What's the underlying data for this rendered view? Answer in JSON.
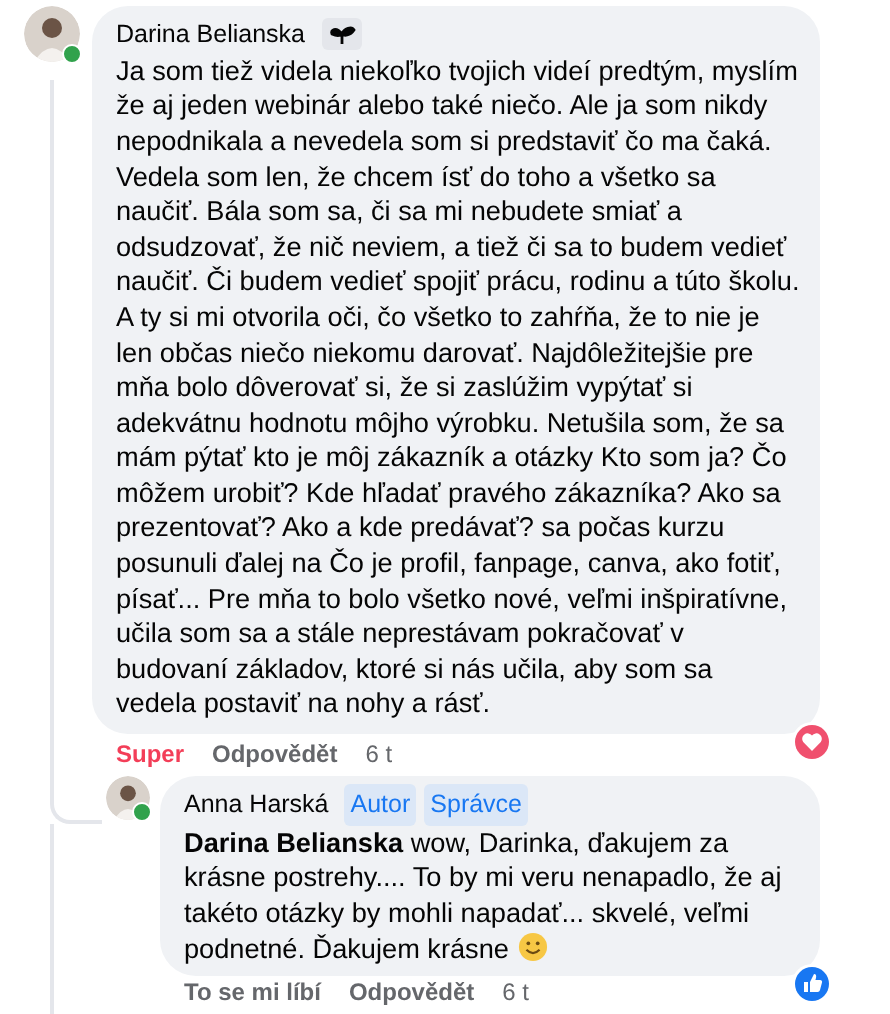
{
  "comment": {
    "author": "Darina Belianska",
    "online": true,
    "text": "Ja som tiež videla niekoľko tvojich videí predtým, myslím že aj jeden webinár alebo také niečo. Ale ja som nikdy nepodnikala a nevedela som si predstaviť čo ma čaká. Vedela som len, že chcem ísť do toho a všetko sa naučiť. Bála som sa, či sa mi nebudete smiať a odsudzovať, že nič neviem, a tiež či sa to budem vedieť naučiť. Či budem vedieť spojiť prácu, rodinu a túto školu. A ty si mi otvorila oči, čo všetko to zahŕňa, že to nie je len občas niečo niekomu darovať. Najdôležitejšie pre mňa bolo dôverovať si, že si zaslúžim vypýtať si adekvátnu hodnotu môjho výrobku. Netušila som, že sa mám pýtať kto je môj zákazník a otázky Kto som ja? Čo môžem urobiť? Kde hľadať pravého zákazníka? Ako sa prezentovať? Ako a kde predávať? sa počas kurzu posunuli ďalej na Čo je profil, fanpage, canva, ako fotiť, písať... Pre mňa to bolo všetko nové, veľmi inšpiratívne, učila som sa a stále neprestávam pokračovať v budovaní základov, ktoré si nás učila, aby som sa vedela postaviť na nohy a rásť.",
    "reaction": {
      "label": "Super",
      "reacted": true,
      "kind": "heart"
    },
    "reply_label": "Odpovědět",
    "time": "6 t"
  },
  "reply": {
    "author": "Anna Harská",
    "online": true,
    "badges": [
      "Autor",
      "Správce"
    ],
    "text": "**Darina Belianska** wow, Darinka, ďakujem za krásne postrehy.... To by mi veru nenapadlo, že aj takéto otázky by mohli napadať... skvelé, veľmi podnetné. Ďakujem krásne",
    "reaction": {
      "label": "To se mi líbí",
      "reacted": false,
      "kind": "like"
    },
    "reply_label": "Odpovědět",
    "time": "6 t"
  }
}
